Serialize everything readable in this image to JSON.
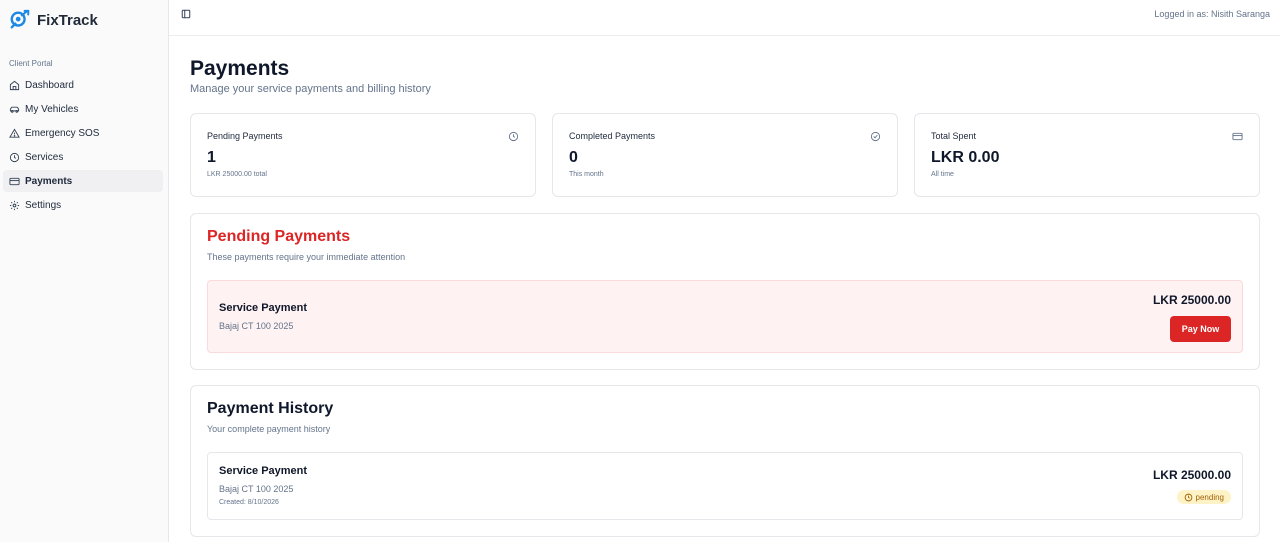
{
  "app": {
    "name": "FixTrack"
  },
  "sidebar": {
    "section_label": "Client Portal",
    "items": [
      {
        "label": "Dashboard",
        "icon": "home-icon"
      },
      {
        "label": "My Vehicles",
        "icon": "car-icon"
      },
      {
        "label": "Emergency SOS",
        "icon": "alert-triangle-icon"
      },
      {
        "label": "Services",
        "icon": "clock-icon"
      },
      {
        "label": "Payments",
        "icon": "credit-card-icon",
        "active": true
      },
      {
        "label": "Settings",
        "icon": "gear-icon"
      }
    ]
  },
  "topbar": {
    "logged_in": "Logged in as: Nisith Saranga"
  },
  "page": {
    "title": "Payments",
    "subtitle": "Manage your service payments and billing history"
  },
  "stats": [
    {
      "label": "Pending Payments",
      "value": "1",
      "note": "LKR 25000.00 total",
      "icon": "clock-icon"
    },
    {
      "label": "Completed Payments",
      "value": "0",
      "note": "This month",
      "icon": "check-circle-icon"
    },
    {
      "label": "Total Spent",
      "value": "LKR 0.00",
      "note": "All time",
      "icon": "credit-card-icon"
    }
  ],
  "pending": {
    "title": "Pending Payments",
    "subtitle": "These payments require your immediate attention",
    "item": {
      "title": "Service Payment",
      "vehicle": "Bajaj CT 100 2025",
      "amount": "LKR 25000.00",
      "action": "Pay Now"
    }
  },
  "history": {
    "title": "Payment History",
    "subtitle": "Your complete payment history",
    "item": {
      "title": "Service Payment",
      "vehicle": "Bajaj CT 100 2025",
      "created": "Created: 8/10/2026",
      "amount": "LKR 25000.00",
      "status": "pending"
    }
  },
  "colors": {
    "accent": "#dc2626",
    "brand": "#1e88e5",
    "pending_badge_bg": "#fef3c7",
    "pending_badge_text": "#a16207"
  }
}
